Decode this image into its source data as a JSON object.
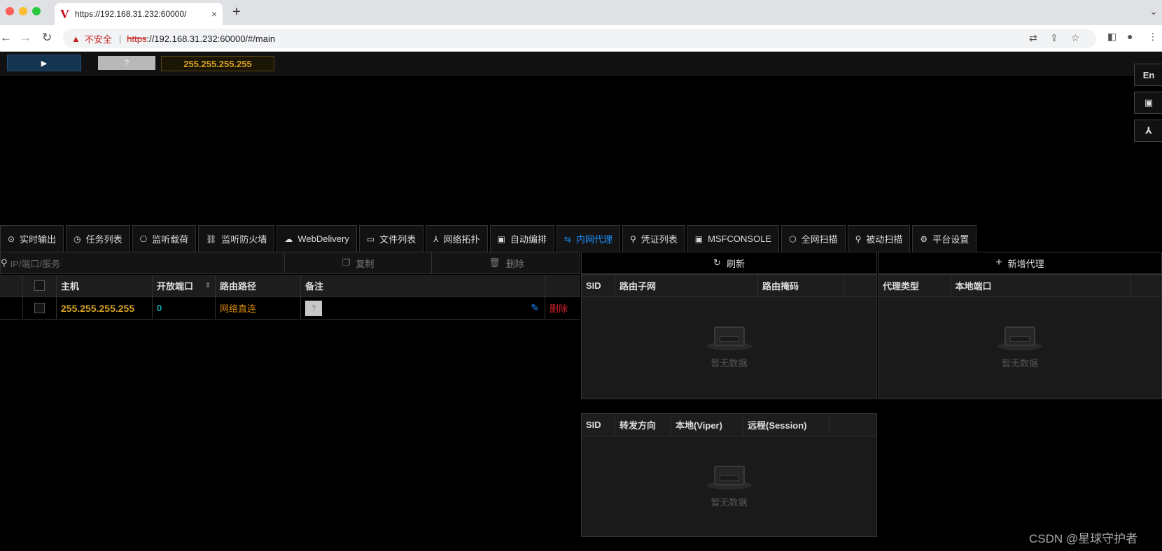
{
  "browser": {
    "tab_title": "https://192.168.31.232:60000/",
    "favicon": "V",
    "close": "×",
    "new_tab": "+",
    "not_secure": "不安全",
    "url_scheme": "https",
    "url_rest": "://192.168.31.232:60000/#/main"
  },
  "header": {
    "help": "?",
    "ip": "255.255.255.255"
  },
  "side": {
    "lang": "En"
  },
  "tabs": [
    {
      "label": "实时输出",
      "icon": "⊙"
    },
    {
      "label": "任务列表",
      "icon": "◷"
    },
    {
      "label": "监听载荷",
      "icon": "⎔"
    },
    {
      "label": "监听防火墙",
      "icon": "⛓"
    },
    {
      "label": "WebDelivery",
      "icon": "☁"
    },
    {
      "label": "文件列表",
      "icon": "▭"
    },
    {
      "label": "网络拓扑",
      "icon": "⅄"
    },
    {
      "label": "自动编排",
      "icon": "▣"
    },
    {
      "label": "内网代理",
      "icon": "⇆"
    },
    {
      "label": "凭证列表",
      "icon": "⚲"
    },
    {
      "label": "MSFCONSOLE",
      "icon": "▣"
    },
    {
      "label": "全网扫描",
      "icon": "⬡"
    },
    {
      "label": "被动扫描",
      "icon": "⚲"
    },
    {
      "label": "平台设置",
      "icon": "⚙"
    }
  ],
  "toolbar": {
    "search_placeholder": "IP/端口/服务",
    "copy": "复制",
    "delete": "删除",
    "refresh": "刷新",
    "add_proxy": "新增代理"
  },
  "host_table": {
    "columns": [
      "主机",
      "开放端口",
      "路由路径",
      "备注"
    ],
    "rows": [
      {
        "host": "255.255.255.255",
        "ports": "0",
        "route": "网络直连",
        "note": "?",
        "delete": "删除"
      }
    ]
  },
  "route_table": {
    "columns": [
      "SID",
      "路由子网",
      "路由掩码"
    ],
    "empty": "暂无数据"
  },
  "proxy_table": {
    "columns": [
      "代理类型",
      "本地端口"
    ],
    "empty": "暂无数据"
  },
  "forward_table": {
    "columns": [
      "SID",
      "转发方向",
      "本地(Viper)",
      "远程(Session)"
    ],
    "empty": "暂无数据"
  },
  "watermark": "CSDN @星球守护者",
  "colors": {
    "accent": "#1890ff",
    "ip": "#d8a324",
    "port": "#13a8a8",
    "route": "#d48806",
    "danger": "#d32029"
  }
}
